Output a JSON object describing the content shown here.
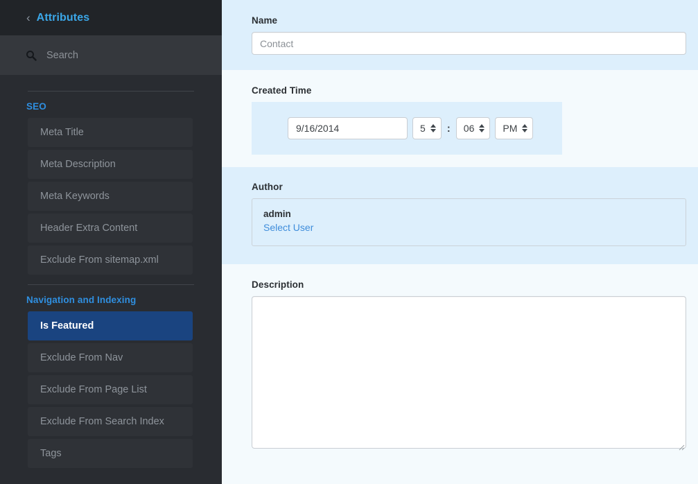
{
  "sidebar": {
    "back_icon": "chevron-left-icon",
    "title": "Attributes",
    "search": {
      "icon": "search-icon",
      "placeholder": "Search",
      "value": ""
    },
    "sections": [
      {
        "title": "SEO",
        "items": [
          {
            "label": "Meta Title",
            "active": false
          },
          {
            "label": "Meta Description",
            "active": false
          },
          {
            "label": "Meta Keywords",
            "active": false
          },
          {
            "label": "Header Extra Content",
            "active": false
          },
          {
            "label": "Exclude From sitemap.xml",
            "active": false
          }
        ]
      },
      {
        "title": "Navigation and Indexing",
        "items": [
          {
            "label": "Is Featured",
            "active": true
          },
          {
            "label": "Exclude From Nav",
            "active": false
          },
          {
            "label": "Exclude From Page List",
            "active": false
          },
          {
            "label": "Exclude From Search Index",
            "active": false
          },
          {
            "label": "Tags",
            "active": false
          }
        ]
      }
    ]
  },
  "main": {
    "name": {
      "label": "Name",
      "value": "Contact",
      "placeholder": "Contact"
    },
    "created_time": {
      "label": "Created Time",
      "date": "9/16/2014",
      "hour": "5",
      "separator": ":",
      "minute": "06",
      "meridiem": "PM"
    },
    "author": {
      "label": "Author",
      "name": "admin",
      "select_user_link": "Select User"
    },
    "description": {
      "label": "Description",
      "value": "",
      "placeholder": ""
    }
  },
  "colors": {
    "sidebar_bg": "#292c31",
    "sidebar_header_bg": "#212428",
    "search_bg": "#35383d",
    "accent_blue": "#3ba7e8",
    "section_title_blue": "#2f8fe0",
    "active_item_bg": "#1a4480",
    "panel_light": "#f4fafd",
    "panel_alt": "#ddeffc",
    "link_blue": "#3f8ddb"
  }
}
